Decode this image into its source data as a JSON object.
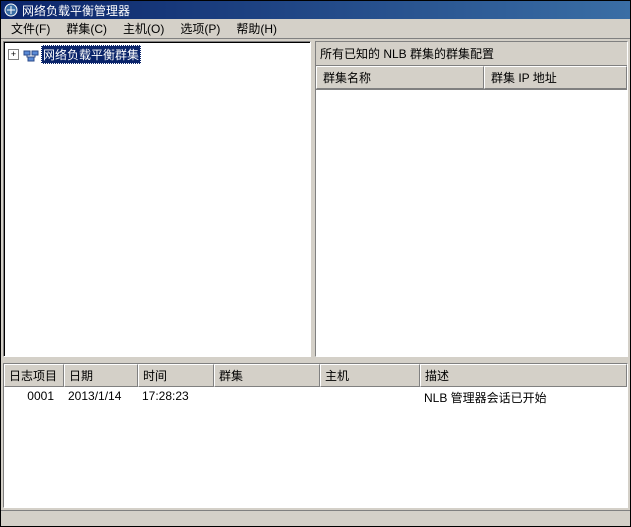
{
  "titlebar": {
    "title": "网络负载平衡管理器"
  },
  "menu": {
    "file": "文件(F)",
    "cluster": "群集(C)",
    "host": "主机(O)",
    "options": "选项(P)",
    "help": "帮助(H)"
  },
  "tree": {
    "root_label": "网络负载平衡群集",
    "expander": "+"
  },
  "right_panel": {
    "heading": "所有已知的 NLB 群集的群集配置",
    "col_name": "群集名称",
    "col_ip": "群集 IP 地址"
  },
  "log": {
    "headers": {
      "item": "日志项目",
      "date": "日期",
      "time": "时间",
      "cluster": "群集",
      "host": "主机",
      "desc": "描述"
    },
    "rows": [
      {
        "item": "0001",
        "date": "2013/1/14",
        "time": "17:28:23",
        "cluster": "",
        "host": "",
        "desc": "NLB 管理器会话已开始"
      }
    ]
  },
  "colors": {
    "titlebar_start": "#0a246a",
    "titlebar_end": "#3a6ea5",
    "face": "#d4d0c8"
  }
}
